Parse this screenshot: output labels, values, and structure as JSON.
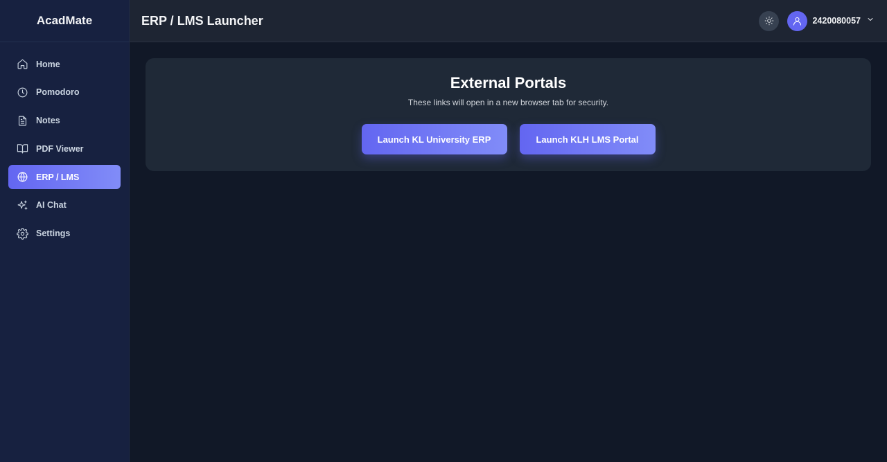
{
  "app": {
    "name": "AcadMate"
  },
  "sidebar": {
    "items": [
      {
        "label": "Home",
        "icon": "home-icon"
      },
      {
        "label": "Pomodoro",
        "icon": "clock-icon"
      },
      {
        "label": "Notes",
        "icon": "file-text-icon"
      },
      {
        "label": "PDF Viewer",
        "icon": "book-open-icon"
      },
      {
        "label": "ERP / LMS",
        "icon": "globe-icon",
        "active": true
      },
      {
        "label": "AI Chat",
        "icon": "sparkles-icon"
      },
      {
        "label": "Settings",
        "icon": "gear-icon"
      }
    ]
  },
  "header": {
    "title": "ERP / LMS Launcher",
    "user_id": "2420080057",
    "theme_icon": "sun-icon",
    "avatar_icon": "user-icon"
  },
  "main": {
    "card_title": "External Portals",
    "card_subtitle": "These links will open in a new browser tab for security.",
    "buttons": {
      "erp": "Launch KL University ERP",
      "lms": "Launch KLH LMS Portal"
    }
  },
  "colors": {
    "accent": "#6366f1",
    "accent_light": "#818cf8",
    "sidebar_bg": "#172140",
    "topbar_bg": "#1e2533",
    "main_bg": "#111827",
    "card_bg": "#1f2937"
  }
}
